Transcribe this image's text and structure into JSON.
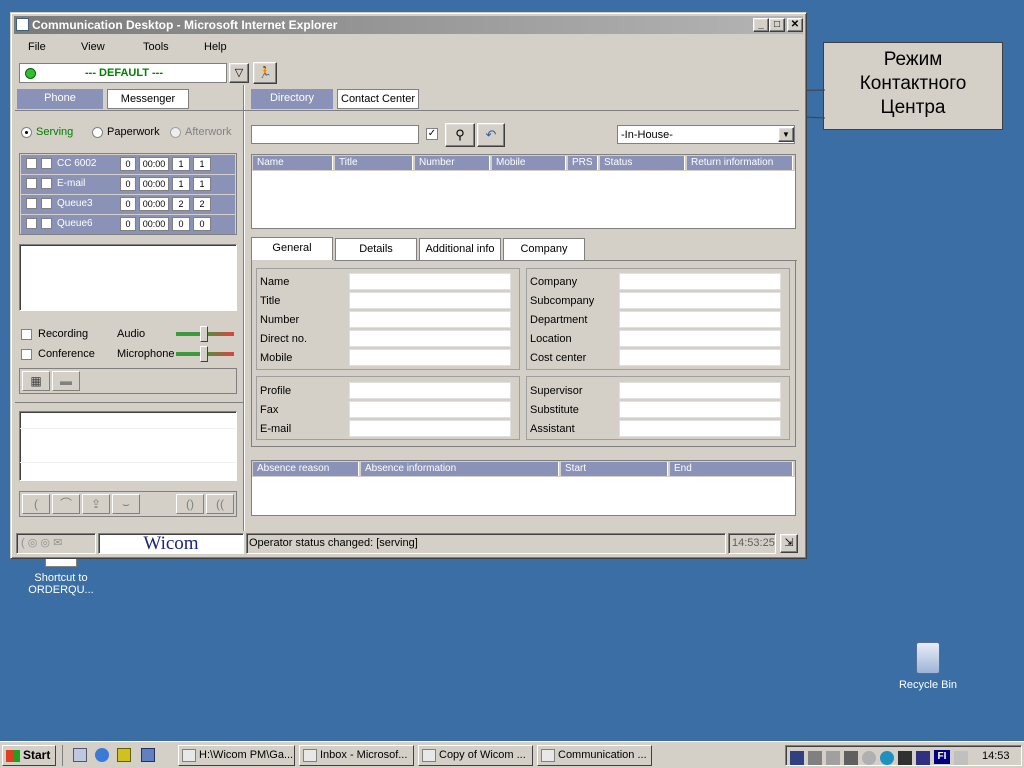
{
  "window": {
    "title": "Communication Desktop - Microsoft Internet Explorer"
  },
  "menu": [
    "File",
    "View",
    "Tools",
    "Help"
  ],
  "profile": {
    "selected": "--- DEFAULT ---"
  },
  "left_tabs": {
    "phone": "Phone",
    "messenger": "Messenger"
  },
  "right_tabs": {
    "directory": "Directory",
    "contact_center": "Contact Center"
  },
  "status_options": {
    "serving": "Serving",
    "paperwork": "Paperwork",
    "afterwork": "Afterwork"
  },
  "queues": [
    {
      "name": "CC 6002",
      "c1": "0",
      "c2": "00:00",
      "c3": "1",
      "c4": "1"
    },
    {
      "name": "E-mail",
      "c1": "0",
      "c2": "00:00",
      "c3": "1",
      "c4": "1"
    },
    {
      "name": "Queue3",
      "c1": "0",
      "c2": "00:00",
      "c3": "2",
      "c4": "2"
    },
    {
      "name": "Queue6",
      "c1": "0",
      "c2": "00:00",
      "c3": "0",
      "c4": "0"
    }
  ],
  "audio": {
    "recording": "Recording",
    "conference": "Conference",
    "audio": "Audio",
    "microphone": "Microphone"
  },
  "search": {
    "location": "-In-House-"
  },
  "result_columns": [
    "Name",
    "Title",
    "Number",
    "Mobile",
    "PRS",
    "Status",
    "Return information"
  ],
  "detail_tabs": [
    "General",
    "Details",
    "Additional info",
    "Company"
  ],
  "form_left_top": [
    "Name",
    "Title",
    "Number",
    "Direct no.",
    "Mobile"
  ],
  "form_right_top": [
    "Company",
    "Subcompany",
    "Department",
    "Location",
    "Cost center"
  ],
  "form_left_bottom": [
    "Profile",
    "Fax",
    "E-mail"
  ],
  "form_right_bottom": [
    "Supervisor",
    "Substitute",
    "Assistant"
  ],
  "absence_columns": [
    "Absence reason",
    "Absence information",
    "Start",
    "End"
  ],
  "statusbar": {
    "brand": "Wicom",
    "message": "Operator status changed: [serving]",
    "time": "14:53:25"
  },
  "callout": {
    "line1": "Режим",
    "line2": "Контактного",
    "line3": "Центра"
  },
  "desktop": {
    "shortcut": "Shortcut to",
    "shortcut2": "ORDERQU...",
    "recycle": "Recycle Bin"
  },
  "taskbar": {
    "start": "Start",
    "tasks": [
      "H:\\Wicom PM\\Ga...",
      "Inbox - Microsof...",
      "Copy of Wicom ...",
      "Communication ..."
    ],
    "lang": "FI",
    "clock": "14:53"
  }
}
